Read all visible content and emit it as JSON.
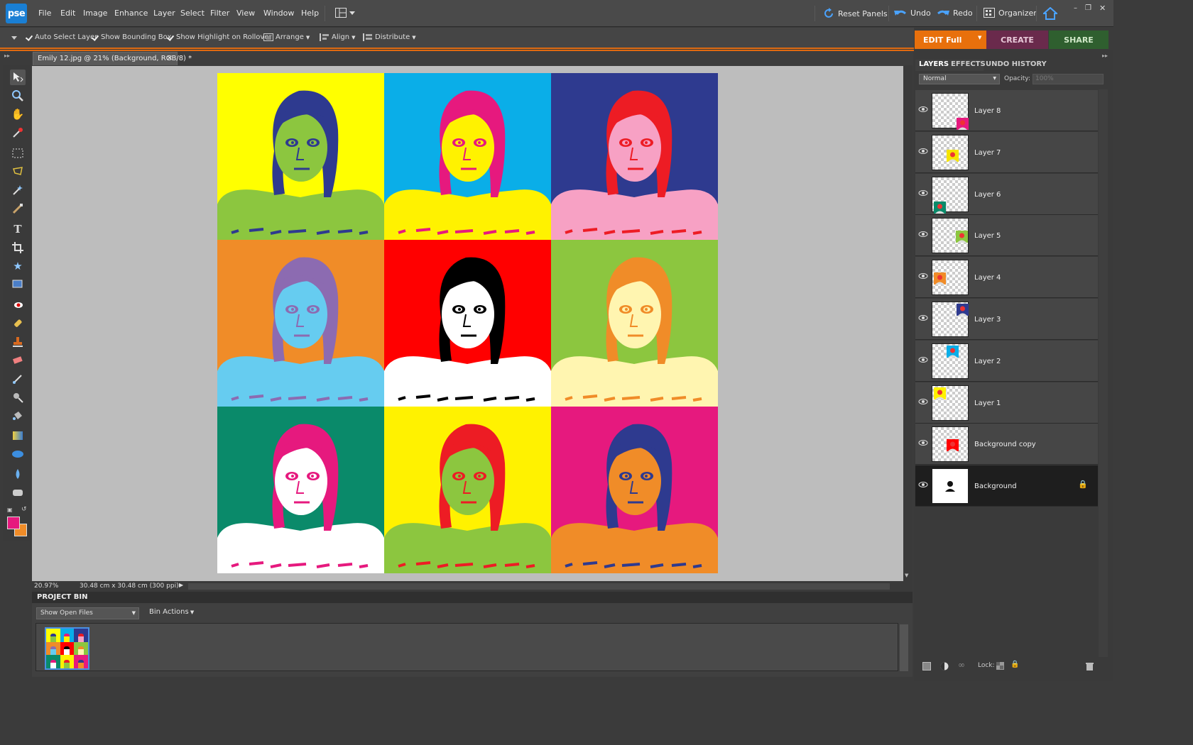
{
  "app": {
    "logo": "pse"
  },
  "menu": [
    "File",
    "Edit",
    "Image",
    "Enhance",
    "Layer",
    "Select",
    "Filter",
    "View",
    "Window",
    "Help"
  ],
  "topbar": {
    "reset_panels": "Reset Panels",
    "undo": "Undo",
    "redo": "Redo",
    "organizer": "Organizer"
  },
  "options": {
    "auto_select": "Auto Select Layer",
    "bounding_box": "Show Bounding Box",
    "highlight": "Show Highlight on Rollover",
    "arrange": "Arrange",
    "align": "Align",
    "distribute": "Distribute"
  },
  "modes": {
    "edit": "EDIT Full",
    "create": "CREATE",
    "share": "SHARE"
  },
  "document": {
    "tab_title": "Emily 12.jpg @ 21% (Background, RGB/8) *"
  },
  "status": {
    "zoom": "20.97%",
    "doc_size": "30.48 cm x 30.48 cm (300 ppi)"
  },
  "project_bin": {
    "title": "PROJECT BIN",
    "show": "Show Open Files",
    "actions": "Bin Actions"
  },
  "panel": {
    "tabs": [
      "LAYERS",
      "EFFECTS",
      "UNDO HISTORY"
    ],
    "blend_mode": "Normal",
    "opacity_label": "Opacity:",
    "opacity_value": "100%",
    "lock_label": "Lock:",
    "layers": [
      {
        "name": "Layer 8",
        "mini_color": "#e6197e"
      },
      {
        "name": "Layer 7",
        "mini_color": "#f5e400"
      },
      {
        "name": "Layer 6",
        "mini_color": "#0a8a6a"
      },
      {
        "name": "Layer 5",
        "mini_color": "#8cc63f"
      },
      {
        "name": "Layer 4",
        "mini_color": "#f08c28"
      },
      {
        "name": "Layer 3",
        "mini_color": "#2e3a8f"
      },
      {
        "name": "Layer 2",
        "mini_color": "#0aaee8"
      },
      {
        "name": "Layer 1",
        "mini_color": "#fff200"
      },
      {
        "name": "Background copy",
        "mini_color": "#ff0000"
      },
      {
        "name": "Background",
        "mini_color": "#ffffff"
      }
    ]
  },
  "artwork": {
    "tiles": [
      {
        "bg": "#ffff00",
        "hair": "#2e3a8f",
        "face": "#8cc63f"
      },
      {
        "bg": "#0aaee8",
        "hair": "#e6197e",
        "face": "#fff200"
      },
      {
        "bg": "#2e3a8f",
        "hair": "#ed1c24",
        "face": "#f7a1c4"
      },
      {
        "bg": "#f08c28",
        "hair": "#8c6bb1",
        "face": "#66ccf0"
      },
      {
        "bg": "#ff0000",
        "hair": "#000000",
        "face": "#ffffff"
      },
      {
        "bg": "#8cc63f",
        "hair": "#f08c28",
        "face": "#fff5b0"
      },
      {
        "bg": "#0a8a6a",
        "hair": "#e6197e",
        "face": "#ffffff"
      },
      {
        "bg": "#fff200",
        "hair": "#ed1c24",
        "face": "#8cc63f"
      },
      {
        "bg": "#e6197e",
        "hair": "#2e3a8f",
        "face": "#f08c28"
      }
    ]
  },
  "colors": {
    "foreground": "#e6197e",
    "background": "#f08c28",
    "edit_tab": "#e8700c",
    "create_tab": "#7a2a55",
    "share_tab": "#2f6a2f"
  }
}
